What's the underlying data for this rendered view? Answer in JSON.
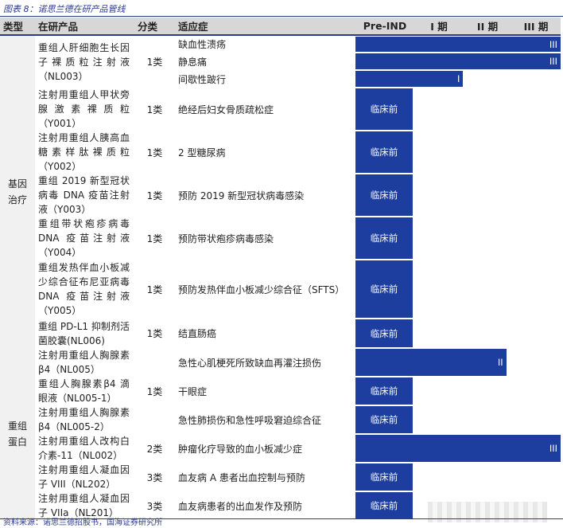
{
  "caption": "图表 8：诺思兰德在研产品管线",
  "headers": {
    "category": "类型",
    "product": "在研产品",
    "class": "分类",
    "indication": "适应症",
    "pre_ind": "Pre-IND",
    "phase1": "I 期",
    "phase2": "II 期",
    "phase3": "III 期"
  },
  "categories": [
    {
      "name": "基因\n治疗"
    },
    {
      "name": "重组\n蛋白"
    }
  ],
  "products": [
    {
      "name": "重组人肝细胞生长因子裸质粒注射液（NL003）",
      "class": "1类"
    },
    {
      "name": "注射用重组人甲状旁腺激素裸质粒（Y001）",
      "class": "1类"
    },
    {
      "name": "注射用重组人胰高血糖素样肽裸质粒（Y002）",
      "class": "1类"
    },
    {
      "name": "重组 2019 新型冠状病毒 DNA 疫苗注射液（Y003）",
      "class": "1类"
    },
    {
      "name": "重组带状疱疹病毒 DNA 疫苗注射液（Y004）",
      "class": "1类"
    },
    {
      "name": "重组发热伴血小板减少综合征布尼亚病毒 DNA 疫苗注射液（Y005）",
      "class": "1类"
    },
    {
      "name": "重组 PD-L1 抑制剂活菌胶囊(NL006)",
      "class": "1类"
    },
    {
      "name": "注射用重组人胸腺素β4（NL005）",
      "class": "1类"
    },
    {
      "name": "重组人胸腺素β4 滴眼液（NL005-1）",
      "class": ""
    },
    {
      "name": "注射用重组人胸腺素β4（NL005-2）",
      "class": ""
    },
    {
      "name": "注射用重组人改构白介素-11（NL002）",
      "class": "2类"
    },
    {
      "name": "注射用重组人凝血因子 VIII（NL202）",
      "class": "3类"
    },
    {
      "name": "注射用重组人凝血因子 VIIa（NL201）",
      "class": "3类"
    }
  ],
  "rows": [
    {
      "indication": "缺血性溃疡",
      "stage": "III"
    },
    {
      "indication": "静息痛",
      "stage": "III"
    },
    {
      "indication": "间歇性跛行",
      "stage": "I"
    },
    {
      "indication": "绝经后妇女骨质疏松症",
      "stage": "临床前"
    },
    {
      "indication": "2 型糖尿病",
      "stage": "临床前"
    },
    {
      "indication": "预防 2019 新型冠状病毒感染",
      "stage": "临床前"
    },
    {
      "indication": "预防带状疱疹病毒感染",
      "stage": "临床前"
    },
    {
      "indication": "预防发热伴血小板减少综合征（SFTS）",
      "stage": "临床前"
    },
    {
      "indication": "结直肠癌",
      "stage": "临床前"
    },
    {
      "indication": "急性心肌梗死所致缺血再灌注损伤",
      "stage": "II"
    },
    {
      "indication": "干眼症",
      "stage": "临床前"
    },
    {
      "indication": "急性肺损伤和急性呼吸窘迫综合征",
      "stage": "临床前"
    },
    {
      "indication": "肿瘤化疗导致的血小板减少症",
      "stage": "III"
    },
    {
      "indication": "血友病 A 患者出血控制与预防",
      "stage": "临床前"
    },
    {
      "indication": "血友病患者的出血发作及预防",
      "stage": "临床前"
    }
  ],
  "footer": "资料来源：诺思兰德招股书，国海证券研究所",
  "colors": {
    "accent": "#2b3a8c",
    "bar": "#1d3e9e",
    "header_bg": "#d7d7d7",
    "stripe": "#f1f1f1"
  }
}
